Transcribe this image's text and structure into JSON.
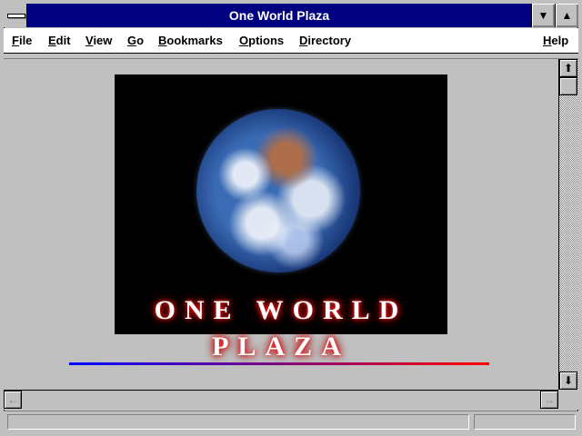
{
  "window": {
    "title": "One World Plaza",
    "minimize_glyph": "▼",
    "maximize_glyph": "▲"
  },
  "menu": {
    "items": [
      {
        "label": "File",
        "hotkey": "F"
      },
      {
        "label": "Edit",
        "hotkey": "E"
      },
      {
        "label": "View",
        "hotkey": "V"
      },
      {
        "label": "Go",
        "hotkey": "G"
      },
      {
        "label": "Bookmarks",
        "hotkey": "B"
      },
      {
        "label": "Options",
        "hotkey": "O"
      },
      {
        "label": "Directory",
        "hotkey": "D"
      }
    ],
    "help": {
      "label": "Help",
      "hotkey": "H"
    }
  },
  "content": {
    "banner_text": "ONE WORLD PLAZA",
    "rule_colors": [
      "#0000ff",
      "#ff0000"
    ]
  },
  "scrollbars": {
    "up_glyph": "⬆",
    "down_glyph": "⬇",
    "left_glyph": "←",
    "right_glyph": "→"
  },
  "status": {
    "text": ""
  },
  "icons": [
    "system-menu-icon",
    "minimize-icon",
    "maximize-icon",
    "scroll-up-icon",
    "scroll-down-icon",
    "scroll-left-icon",
    "scroll-right-icon",
    "earth-image"
  ]
}
